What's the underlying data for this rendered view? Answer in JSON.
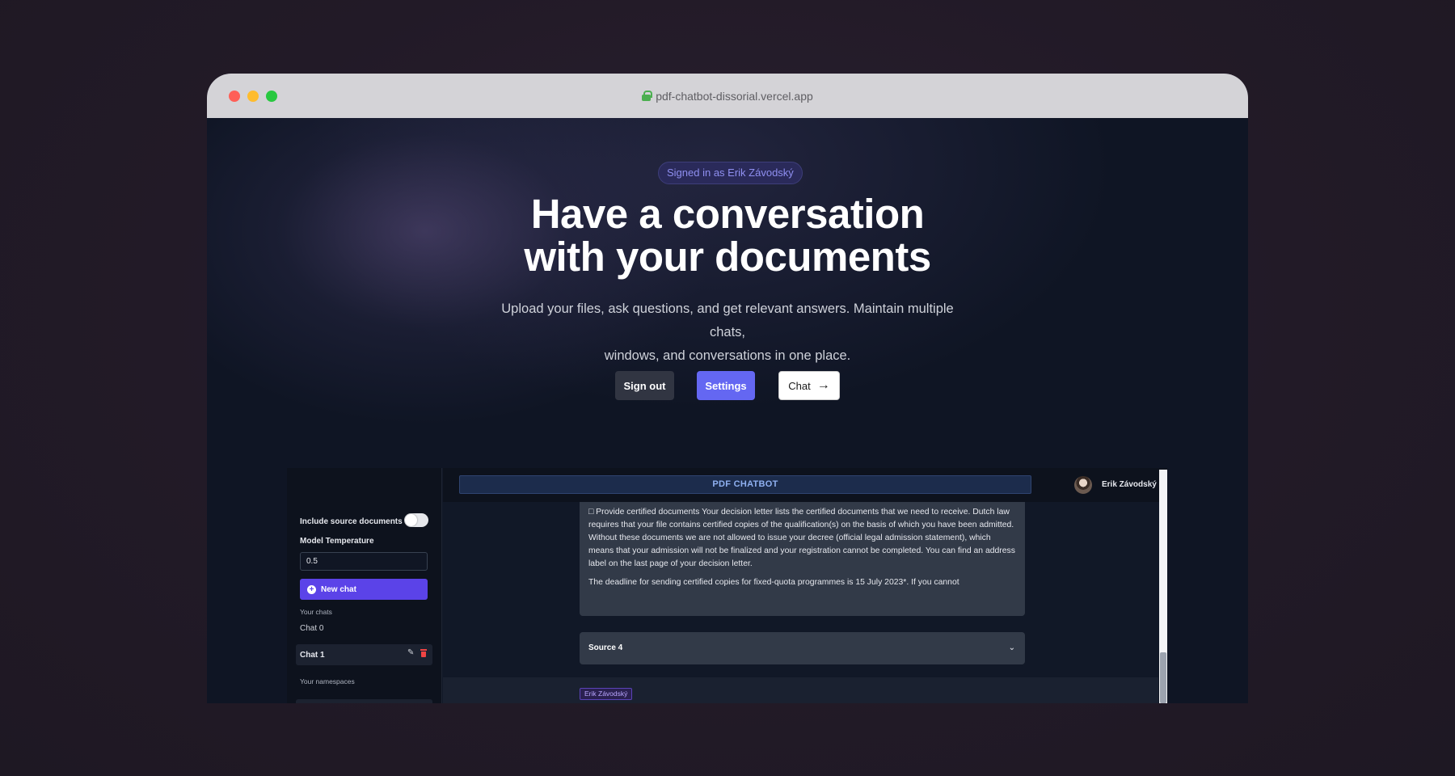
{
  "browser": {
    "url": "pdf-chatbot-dissorial.vercel.app"
  },
  "hero": {
    "badge": "Signed in as Erik Závodský",
    "headline_line1": "Have a conversation",
    "headline_line2": "with your documents",
    "subtitle_line1": "Upload your files, ask questions, and get relevant answers. Maintain multiple chats,",
    "subtitle_line2": "windows, and conversations in one place.",
    "buttons": {
      "sign_out": "Sign out",
      "settings": "Settings",
      "chat": "Chat"
    }
  },
  "app": {
    "title": "PDF CHATBOT",
    "user_name": "Erik Závodský",
    "sidebar": {
      "include_source": "Include source documents",
      "model_temperature_label": "Model Temperature",
      "model_temperature_value": "0.5",
      "new_chat": "New chat",
      "your_chats": "Your chats",
      "chats": [
        "Chat 0",
        "Chat 1"
      ],
      "your_namespaces": "Your namespaces"
    },
    "message": {
      "paragraph1": "□ Provide certified documents Your decision letter lists the certified documents that we need to receive. Dutch law requires that your file contains certified copies of the qualification(s) on the basis of which you have been admitted. Without these documents we are not allowed to issue your decree (official legal admission statement), which means that your admission will not be finalized and your registration cannot be completed. You can find an address label on the last page of your decision letter.",
      "paragraph2": "The deadline for sending certified copies for fixed-quota programmes is 15 July 2023*. If you cannot"
    },
    "source_label": "Source 4",
    "user_tag": "Erik Závodský"
  },
  "colors": {
    "accent": "#6467f2",
    "new_chat_bg": "#5b43e8",
    "background": "#0f1524"
  }
}
